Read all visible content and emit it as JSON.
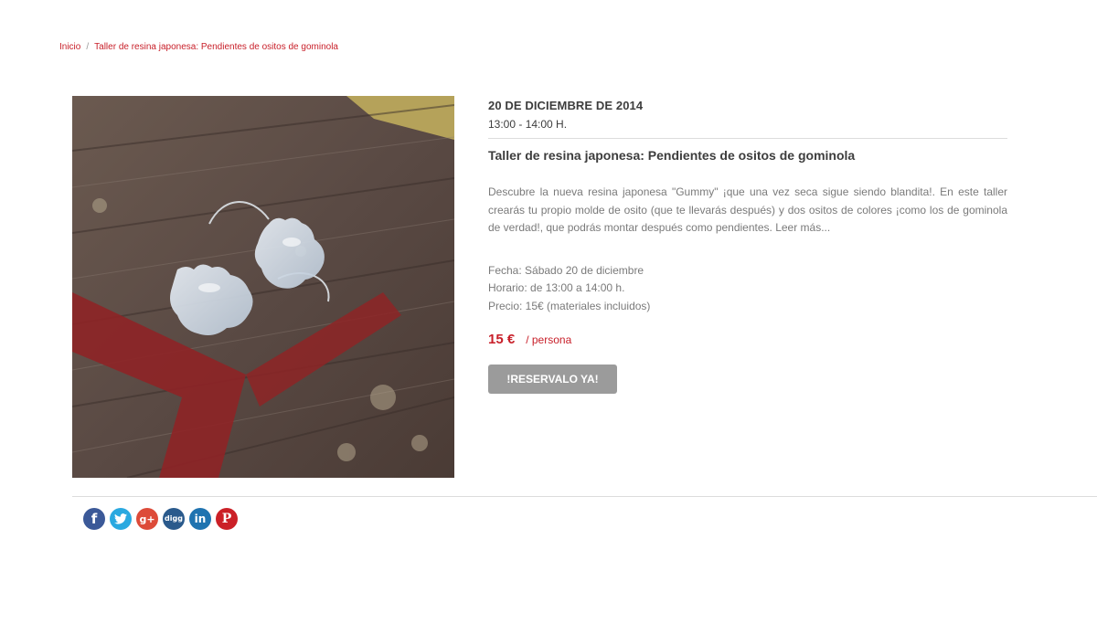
{
  "breadcrumb": {
    "home": "Inicio",
    "separator": "/",
    "current": "Taller de resina japonesa: Pendientes de ositos de gominola"
  },
  "event": {
    "date": "20 DE DICIEMBRE DE 2014",
    "time": "13:00 - 14:00 H.",
    "title": "Taller de resina japonesa: Pendientes de ositos de gominola",
    "description": "Descubre la nueva resina japonesa \"Gummy\" ¡que una vez seca sigue siendo blandita!. En este taller crearás tu propio molde de osito (que te llevarás después) y dos ositos de colores ¡como los de gominola de verdad!, que podrás montar después como pendientes. Leer más...",
    "details": {
      "fecha": "Fecha: Sábado 20 de diciembre",
      "horario": "Horario: de 13:00 a 14:00 h.",
      "precio": "Precio: 15€ (materiales incluidos)"
    },
    "price": "15 €",
    "per": "/ persona",
    "reserve_label": "!RESERVALO YA!"
  },
  "share": [
    {
      "icon": "facebook-icon",
      "glyph": "f",
      "color": "#3b5998"
    },
    {
      "icon": "twitter-icon",
      "glyph": "t",
      "color": "#2aa9e0"
    },
    {
      "icon": "google-plus-icon",
      "glyph": "g+",
      "color": "#dd4b39"
    },
    {
      "icon": "digg-icon",
      "glyph": "digg",
      "color": "#2a5a8c"
    },
    {
      "icon": "linkedin-icon",
      "glyph": "in",
      "color": "#1f73b0"
    },
    {
      "icon": "pinterest-icon",
      "glyph": "P",
      "color": "#cb2027"
    }
  ],
  "colors": {
    "accent": "#c8202a",
    "button": "#9b9b9b",
    "text_dark": "#3d3d3d",
    "text_muted": "#7a7a7a"
  }
}
